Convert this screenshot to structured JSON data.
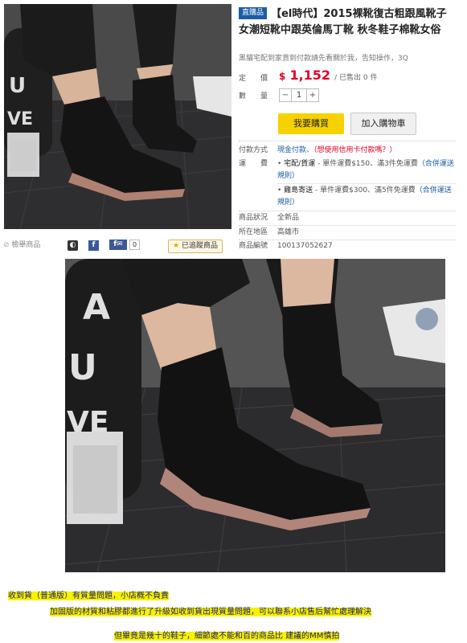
{
  "product": {
    "badge": "直購品",
    "title": "【el時代】2015裸靴復古粗跟風靴子 女潮短靴中跟英倫馬丁靴 秋冬鞋子棉靴女俗",
    "subtitle": "黑貓宅配到家貨到付款請先看關於我，告知操作，3Q",
    "price_label": "定　　價",
    "currency": "$",
    "price": "1,152",
    "sold": "/ 已售出 0 件",
    "qty_label": "數　　量",
    "qty_minus": "−",
    "qty_value": "1",
    "qty_plus": "+",
    "buy_button": "我要購買",
    "cart_button": "加入購物車"
  },
  "payment": {
    "label": "付款方式",
    "value": "現金付款",
    "sep": "、",
    "credit_note": "（想使用信用卡付款嗎？）"
  },
  "shipping": {
    "label": "運　　費",
    "opt1_name": "宅配/貨運",
    "opt1_detail": " - 單件運費$150、滿3件免運費",
    "opt1_link": "（合併運送規則）",
    "opt2_name": "雞島寄送",
    "opt2_detail": " - 單件運費$300、滿5件免運費",
    "opt2_link": "（合併運送規則）"
  },
  "details": {
    "condition_label": "商品狀況",
    "condition_value": "全新品",
    "location_label": "所在地區",
    "location_value": "高雄市",
    "id_label": "商品編號",
    "id_value": "100137052627"
  },
  "share": {
    "report": "檢舉商品",
    "fb_count": "0",
    "tracked": "已追蹤商品"
  },
  "notes": {
    "line1": "收到貨（普通版）有質量問題，小店概不負責",
    "line2": "加固版的材質和粘膠都進行了升級如收到貨出現質量問題，可以聯系小店售后幫忙處理解決",
    "line3": "但畢竟是幾十的鞋子，細節處不能和百的商品比 建議的MM慎拍"
  },
  "colors": {
    "price_red": "#e4002b",
    "buy_yellow": "#f5d200",
    "link_blue": "#1a5da6",
    "note_highlight": "#f7f200"
  }
}
